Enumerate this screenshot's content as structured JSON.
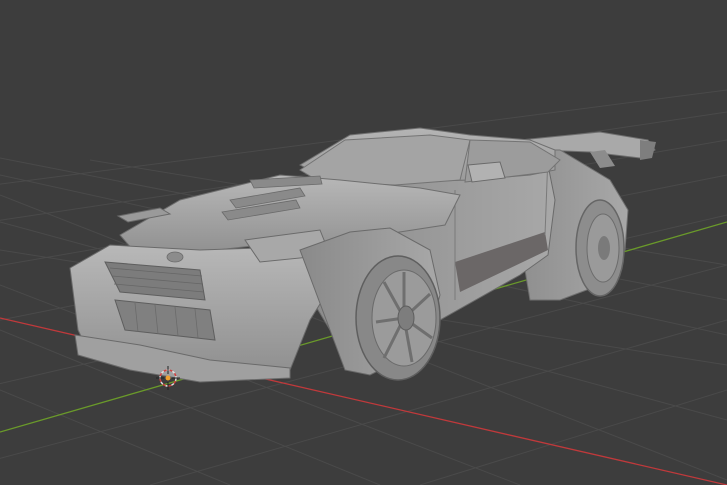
{
  "viewport": {
    "background": "#3d3d3d",
    "grid_color": "#4a4a4a",
    "x_axis_color": "#c0393b",
    "y_axis_color": "#6a9a2a",
    "object": "car-model",
    "object_color": "#a3a3a3",
    "origin_marker_color": "#f0a030"
  }
}
